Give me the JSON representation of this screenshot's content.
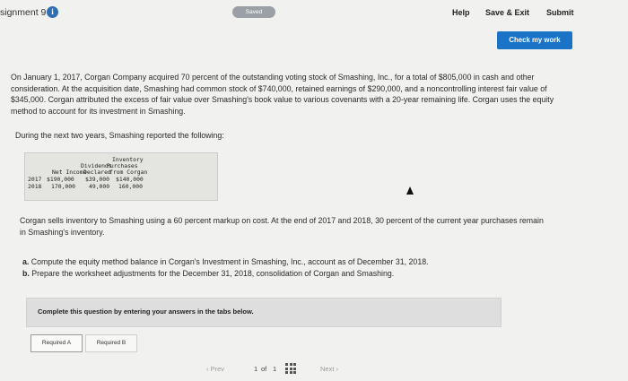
{
  "header": {
    "assignment_title": "signment 9",
    "info_glyph": "i",
    "saved_badge": "Saved",
    "help": "Help",
    "save_exit": "Save & Exit",
    "submit": "Submit"
  },
  "check_button": "Check my work",
  "problem": {
    "intro": "On January 1, 2017, Corgan Company acquired 70 percent of the outstanding voting stock of Smashing, Inc., for a total of $805,000 in cash and other consideration. At the acquisition date, Smashing had common stock of $740,000, retained earnings of $290,000, and a noncontrolling interest fair value of $345,000. Corgan attributed the excess of fair value over Smashing's book value to various covenants with a 20-year remaining life. Corgan uses the equity method to account for its investment in Smashing.",
    "lead_in": "During the next two years, Smashing reported the following:",
    "table": {
      "col_net_income": [
        "Net Income"
      ],
      "col_dividends": [
        "Dividends",
        "Declared"
      ],
      "col_inventory": [
        "Inventory",
        "Purchases",
        "from Corgan"
      ],
      "rows": [
        {
          "year": "2017",
          "net_income": "$190,000",
          "dividends": "$39,000",
          "inventory": "$140,000"
        },
        {
          "year": "2018",
          "net_income": "170,000",
          "dividends": "49,000",
          "inventory": "160,000"
        }
      ]
    },
    "inventory_note": "Corgan sells inventory to Smashing using a 60 percent markup on cost. At the end of 2017 and 2018, 30 percent of the current year purchases remain in Smashing's inventory.",
    "req_a_label": "a.",
    "req_a": "Compute the equity method balance in Corgan's Investment in Smashing, Inc., account as of December 31, 2018.",
    "req_b_label": "b.",
    "req_b": "Prepare the worksheet adjustments for the December 31, 2018, consolidation of Corgan and Smashing."
  },
  "instructions": "Complete this question by entering your answers in the tabs below.",
  "tabs": [
    "Required A",
    "Required B"
  ],
  "pager": {
    "prev": "Prev",
    "current": "1",
    "of": "of",
    "total": "1",
    "next": "Next"
  },
  "colors": {
    "accent": "#1a73c7",
    "info_icon": "#2f6fb3",
    "badge": "#9aa0a6"
  },
  "icons": [
    "info-icon",
    "chevron-left-icon",
    "grid-icon",
    "chevron-right-icon"
  ]
}
